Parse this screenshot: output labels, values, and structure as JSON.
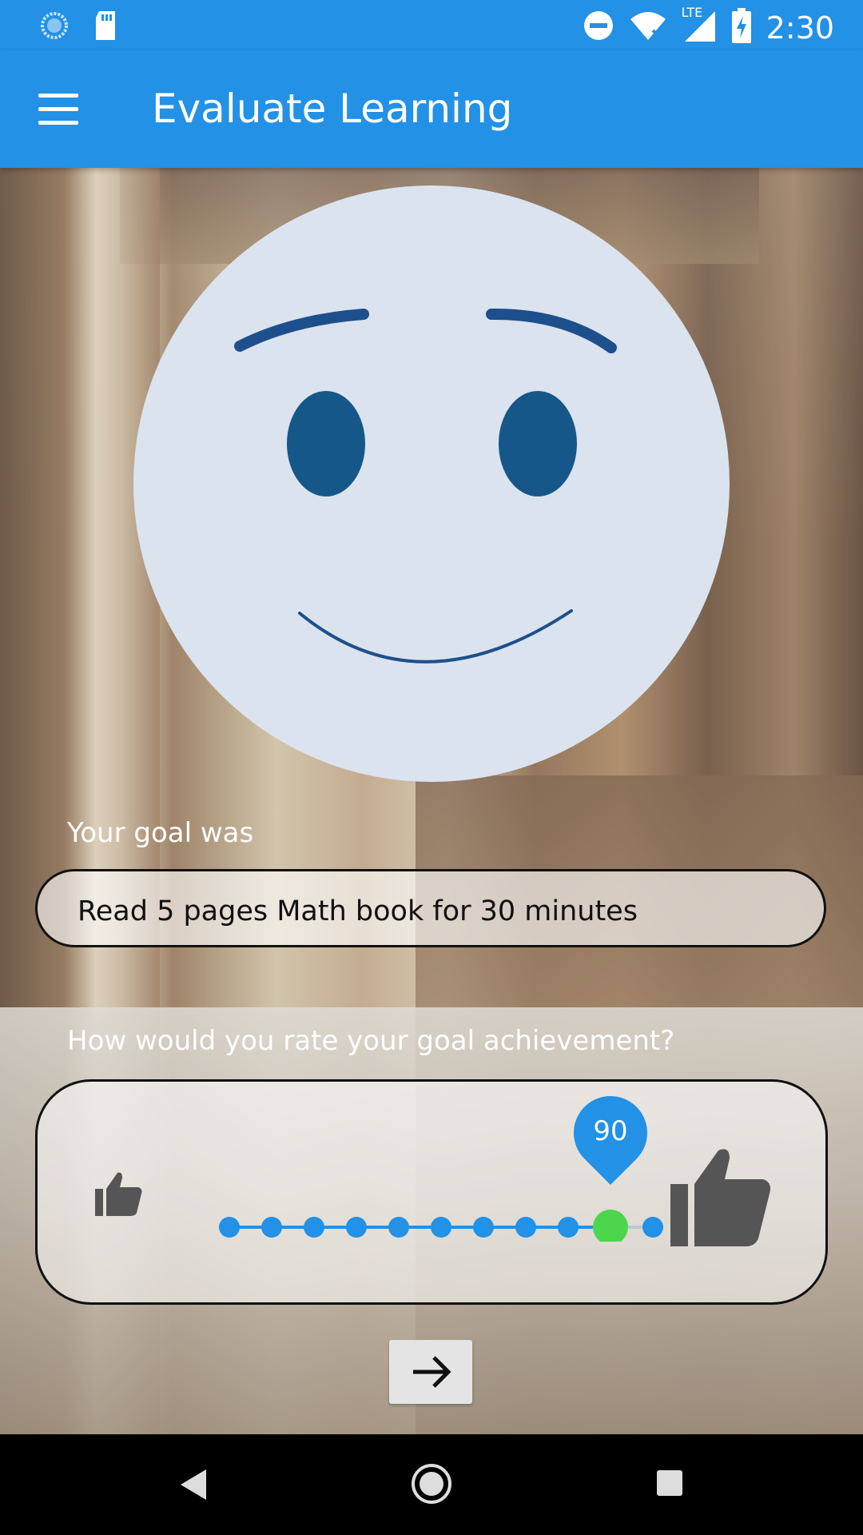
{
  "status_bar": {
    "time": "2:30",
    "network_label": "LTE",
    "icons": [
      "sync-icon",
      "sd-card-icon",
      "do-not-disturb-icon",
      "wifi-icon",
      "signal-icon",
      "battery-charging-icon"
    ]
  },
  "app_bar": {
    "title": "Evaluate Learning",
    "menu_icon": "hamburger-menu-icon",
    "color": "#2291e6"
  },
  "face": {
    "expression": "slight-smile",
    "fill_color": "#dbe3ee",
    "feature_color": "#16578a"
  },
  "goal": {
    "label": "Your goal was",
    "text": "Read 5 pages Math book for 30 minutes"
  },
  "rating": {
    "question": "How would you rate your goal achievement?",
    "value": 90,
    "value_label": "90",
    "min": 0,
    "max": 100,
    "step": 10,
    "low_icon": "thumbs-up-small-icon",
    "high_icon": "thumbs-up-large-icon",
    "accent_color": "#2291e6",
    "thumb_color": "#4cd64c"
  },
  "next_button": {
    "icon": "arrow-right-icon"
  },
  "nav_bar": {
    "icons": [
      "back-icon",
      "home-icon",
      "recents-icon"
    ]
  }
}
